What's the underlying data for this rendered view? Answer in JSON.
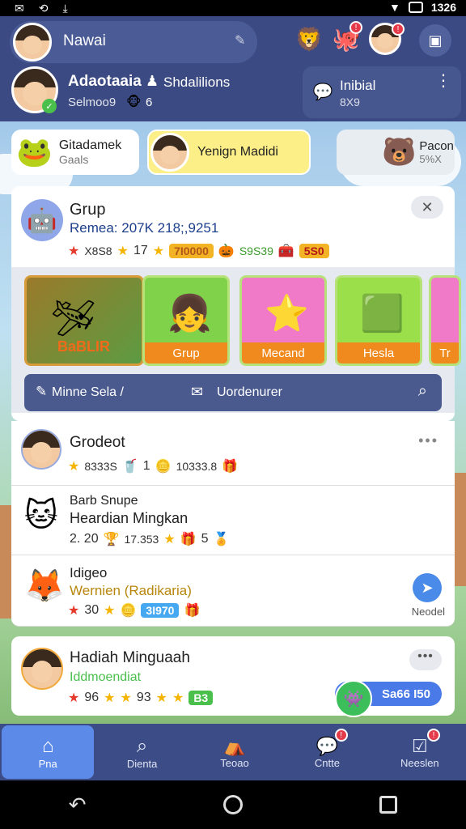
{
  "status": {
    "time": "1326"
  },
  "header": {
    "name": "Nawai",
    "profile_name": "Adaotaaia",
    "profile_role": "Shdalilions",
    "profile_sub": "Selmoo9",
    "profile_sub2": "6",
    "side_title": "Inibial",
    "side_sub": "8X9"
  },
  "cards": {
    "c1_title": "Gitadamek",
    "c1_sub": "Gaals",
    "c2_title": "Yenign Madidi",
    "c3_title": "Pacon",
    "c3_sub": "5%X"
  },
  "main": {
    "title": "Grup",
    "remark": "Remea: 207K 218;,9251",
    "s1": "X8S8",
    "s2": "17",
    "s3": "7I0000",
    "s4": "S9S39",
    "s5": "5S0",
    "banner": "BaBLIR",
    "tiles": [
      "Grup",
      "Mecand",
      "Hesla",
      "Tr"
    ],
    "search_left": "Minne Sela /",
    "search_mid": "Uordenurer"
  },
  "list": [
    {
      "title": "Grodeot",
      "a": "8333S",
      "b": "1",
      "c": "10333.8"
    },
    {
      "title": "Barb Snupe",
      "sub": "Heardian Mingkan",
      "a": "2. 20",
      "b": "17.353",
      "c": "5"
    },
    {
      "title": "Idigeo",
      "sub": "Wernien (Radikaria)",
      "a": "30",
      "b": "3I970",
      "action": "Neodel"
    },
    {
      "title": "Hadiah Minguaah",
      "sub": "Iddmoendiat",
      "a": "96",
      "b": "93",
      "c": "B3",
      "pill": "Sa66 I50"
    }
  ],
  "nav": [
    "Pna",
    "Dienta",
    "Teoao",
    "Cntte",
    "Neeslen"
  ],
  "colors": {
    "header": "#3b4a82",
    "accent": "#5c8ae8",
    "orange": "#f08a1e"
  }
}
